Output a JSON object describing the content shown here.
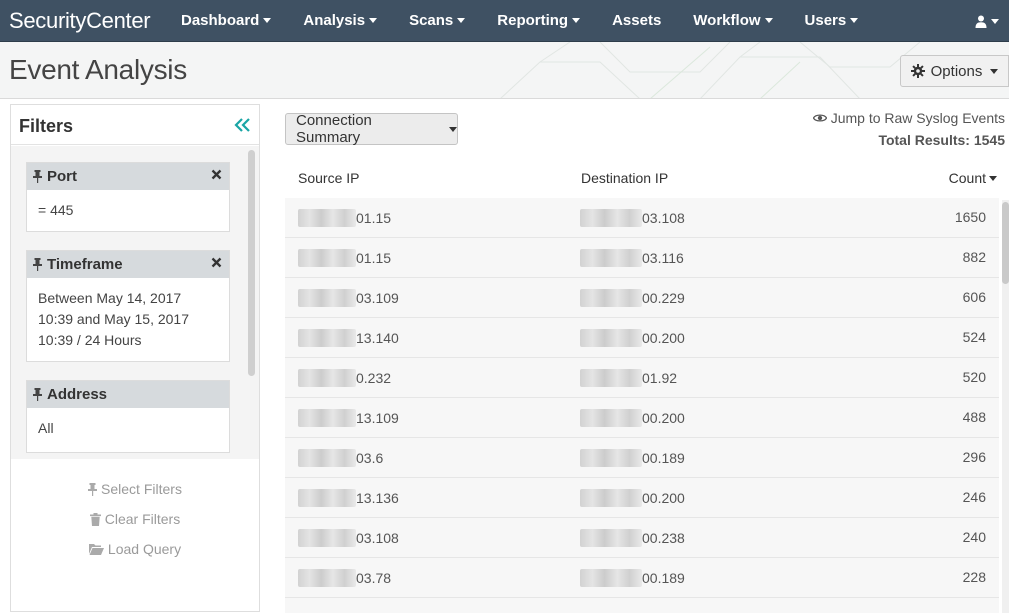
{
  "app": {
    "brand": "SecurityCenter"
  },
  "nav": {
    "items": [
      {
        "label": "Dashboard",
        "dropdown": true
      },
      {
        "label": "Analysis",
        "dropdown": true
      },
      {
        "label": "Scans",
        "dropdown": true
      },
      {
        "label": "Reporting",
        "dropdown": true
      },
      {
        "label": "Assets",
        "dropdown": false
      },
      {
        "label": "Workflow",
        "dropdown": true
      },
      {
        "label": "Users",
        "dropdown": true
      }
    ],
    "user_icon": "user-icon"
  },
  "header": {
    "title": "Event Analysis",
    "options_label": "Options",
    "options_icon": "gear-icon"
  },
  "filters": {
    "title": "Filters",
    "collapse_icon": "double-chevron-left-icon",
    "cards": [
      {
        "title": "Port",
        "value": "= 445"
      },
      {
        "title": "Timeframe",
        "value": "Between May 14, 2017 10:39 and May 15, 2017 10:39 / 24 Hours"
      },
      {
        "title": "Address",
        "value": "All"
      }
    ],
    "actions": {
      "select": "Select Filters",
      "clear": "Clear Filters",
      "load": "Load Query"
    }
  },
  "main": {
    "tool_label": "Connection Summary",
    "jump_link": "Jump to Raw Syslog Events",
    "total_results": "Total Results: 1545",
    "columns": {
      "source": "Source IP",
      "destination": "Destination IP",
      "count": "Count"
    },
    "rows": [
      {
        "src": "01.15",
        "dst": "03.108",
        "count": "1650"
      },
      {
        "src": "01.15",
        "dst": "03.116",
        "count": "882"
      },
      {
        "src": "03.109",
        "dst": "00.229",
        "count": "606"
      },
      {
        "src": "13.140",
        "dst": "00.200",
        "count": "524"
      },
      {
        "src": "0.232",
        "dst": "01.92",
        "count": "520"
      },
      {
        "src": "13.109",
        "dst": "00.200",
        "count": "488"
      },
      {
        "src": "03.6",
        "dst": "00.189",
        "count": "296"
      },
      {
        "src": "13.136",
        "dst": "00.200",
        "count": "246"
      },
      {
        "src": "03.108",
        "dst": "00.238",
        "count": "240"
      },
      {
        "src": "03.78",
        "dst": "00.189",
        "count": "228"
      }
    ]
  },
  "colors": {
    "nav_bg": "#3f5163",
    "accent_teal": "#1aa5a5"
  }
}
